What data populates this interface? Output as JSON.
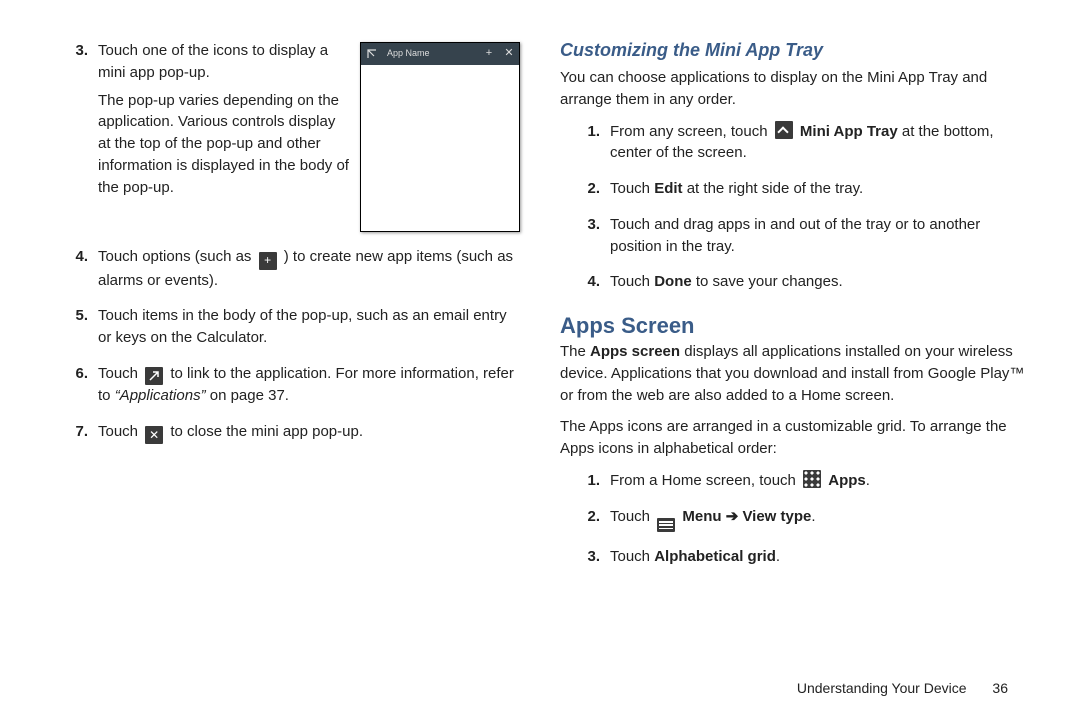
{
  "left": {
    "step3_marker": "3.",
    "step3_a": "Touch one of the icons to display a mini app pop-up.",
    "step3_b": "The pop-up varies depending on the application. Various controls display at the top of the pop-up and other information is displayed in the body of the pop-up.",
    "step4_marker": "4.",
    "step4_pre": "Touch options (such as ",
    "step4_post": " ) to create new app items (such as alarms or events).",
    "step5_marker": "5.",
    "step5": "Touch items in the body of the pop-up, such as an email entry or keys on the Calculator.",
    "step6_marker": "6.",
    "step6_pre": "Touch ",
    "step6_mid": " to link to the application. For more information, refer to ",
    "step6_ref": "“Applications”",
    "step6_post": " on page 37.",
    "step7_marker": "7.",
    "step7_pre": "Touch ",
    "step7_post": " to close the mini app pop-up.",
    "popup_title": "App Name"
  },
  "right": {
    "subhead": "Customizing the Mini App Tray",
    "intro": "You can choose applications to display on the Mini App Tray and arrange them in any order.",
    "c1_marker": "1.",
    "c1_pre": "From any screen, touch ",
    "c1_bold": "Mini App Tray",
    "c1_post": " at the bottom, center of the screen.",
    "c2_marker": "2.",
    "c2_pre": "Touch ",
    "c2_bold": "Edit",
    "c2_post": " at the right side of the tray.",
    "c3_marker": "3.",
    "c3": "Touch and drag apps in and out of the tray or to another position in the tray.",
    "c4_marker": "4.",
    "c4_pre": "Touch ",
    "c4_bold": "Done",
    "c4_post": " to save your changes.",
    "section_head": "Apps Screen",
    "apps_p1_pre": "The ",
    "apps_p1_bold": "Apps screen",
    "apps_p1_post": " displays all applications installed on your wireless device. Applications that you download and install from Google Play™ or from the web are also added to a Home screen.",
    "apps_p2": "The Apps icons are arranged in a customizable grid. To arrange the Apps icons in alphabetical order:",
    "a1_marker": "1.",
    "a1_pre": "From a Home screen, touch ",
    "a1_bold": "Apps",
    "a1_post": ".",
    "a2_marker": "2.",
    "a2_pre": "Touch ",
    "a2_bold": "Menu ➔ View type",
    "a2_post": ".",
    "a3_marker": "3.",
    "a3_pre": "Touch ",
    "a3_bold": "Alphabetical grid",
    "a3_post": "."
  },
  "footer": {
    "section": "Understanding Your Device",
    "page": "36"
  }
}
